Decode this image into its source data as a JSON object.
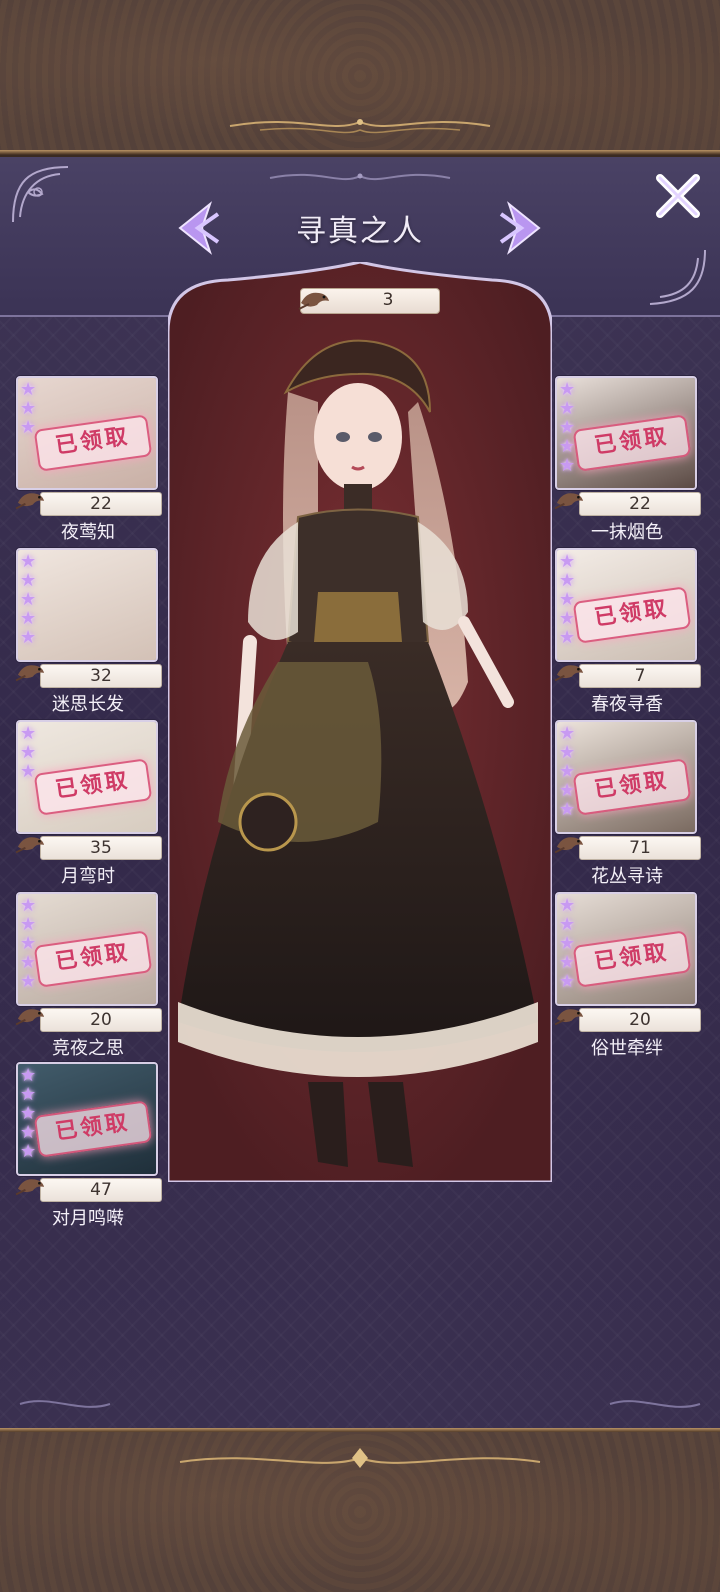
{
  "header": {
    "title": "寻真之人",
    "count": "3"
  },
  "icons": {
    "prev": "chevron-left-icon",
    "next": "chevron-right-icon",
    "close": "close-icon",
    "currency": "nightingale-bird-icon",
    "rarity": "star-icon"
  },
  "stamp_text": "已领取",
  "colors": {
    "panel": "#3b3355",
    "accent_purple": "#b996f0",
    "stamp_pink": "#cf3b66",
    "gold": "#b89364"
  },
  "left_items": [
    {
      "name": "夜莺知",
      "cost": "22",
      "stars": 3,
      "claimed": true
    },
    {
      "name": "迷思长发",
      "cost": "32",
      "stars": 5,
      "claimed": false
    },
    {
      "name": "月弯时",
      "cost": "35",
      "stars": 3,
      "claimed": true
    },
    {
      "name": "竞夜之思",
      "cost": "20",
      "stars": 5,
      "claimed": true
    },
    {
      "name": "对月鸣啭",
      "cost": "47",
      "stars": 5,
      "claimed": true
    }
  ],
  "right_items": [
    {
      "name": "一抹烟色",
      "cost": "22",
      "stars": 5,
      "claimed": true
    },
    {
      "name": "春夜寻香",
      "cost": "7",
      "stars": 5,
      "claimed": true
    },
    {
      "name": "花丛寻诗",
      "cost": "71",
      "stars": 5,
      "claimed": true
    },
    {
      "name": "俗世牵绊",
      "cost": "20",
      "stars": 5,
      "claimed": true
    }
  ]
}
